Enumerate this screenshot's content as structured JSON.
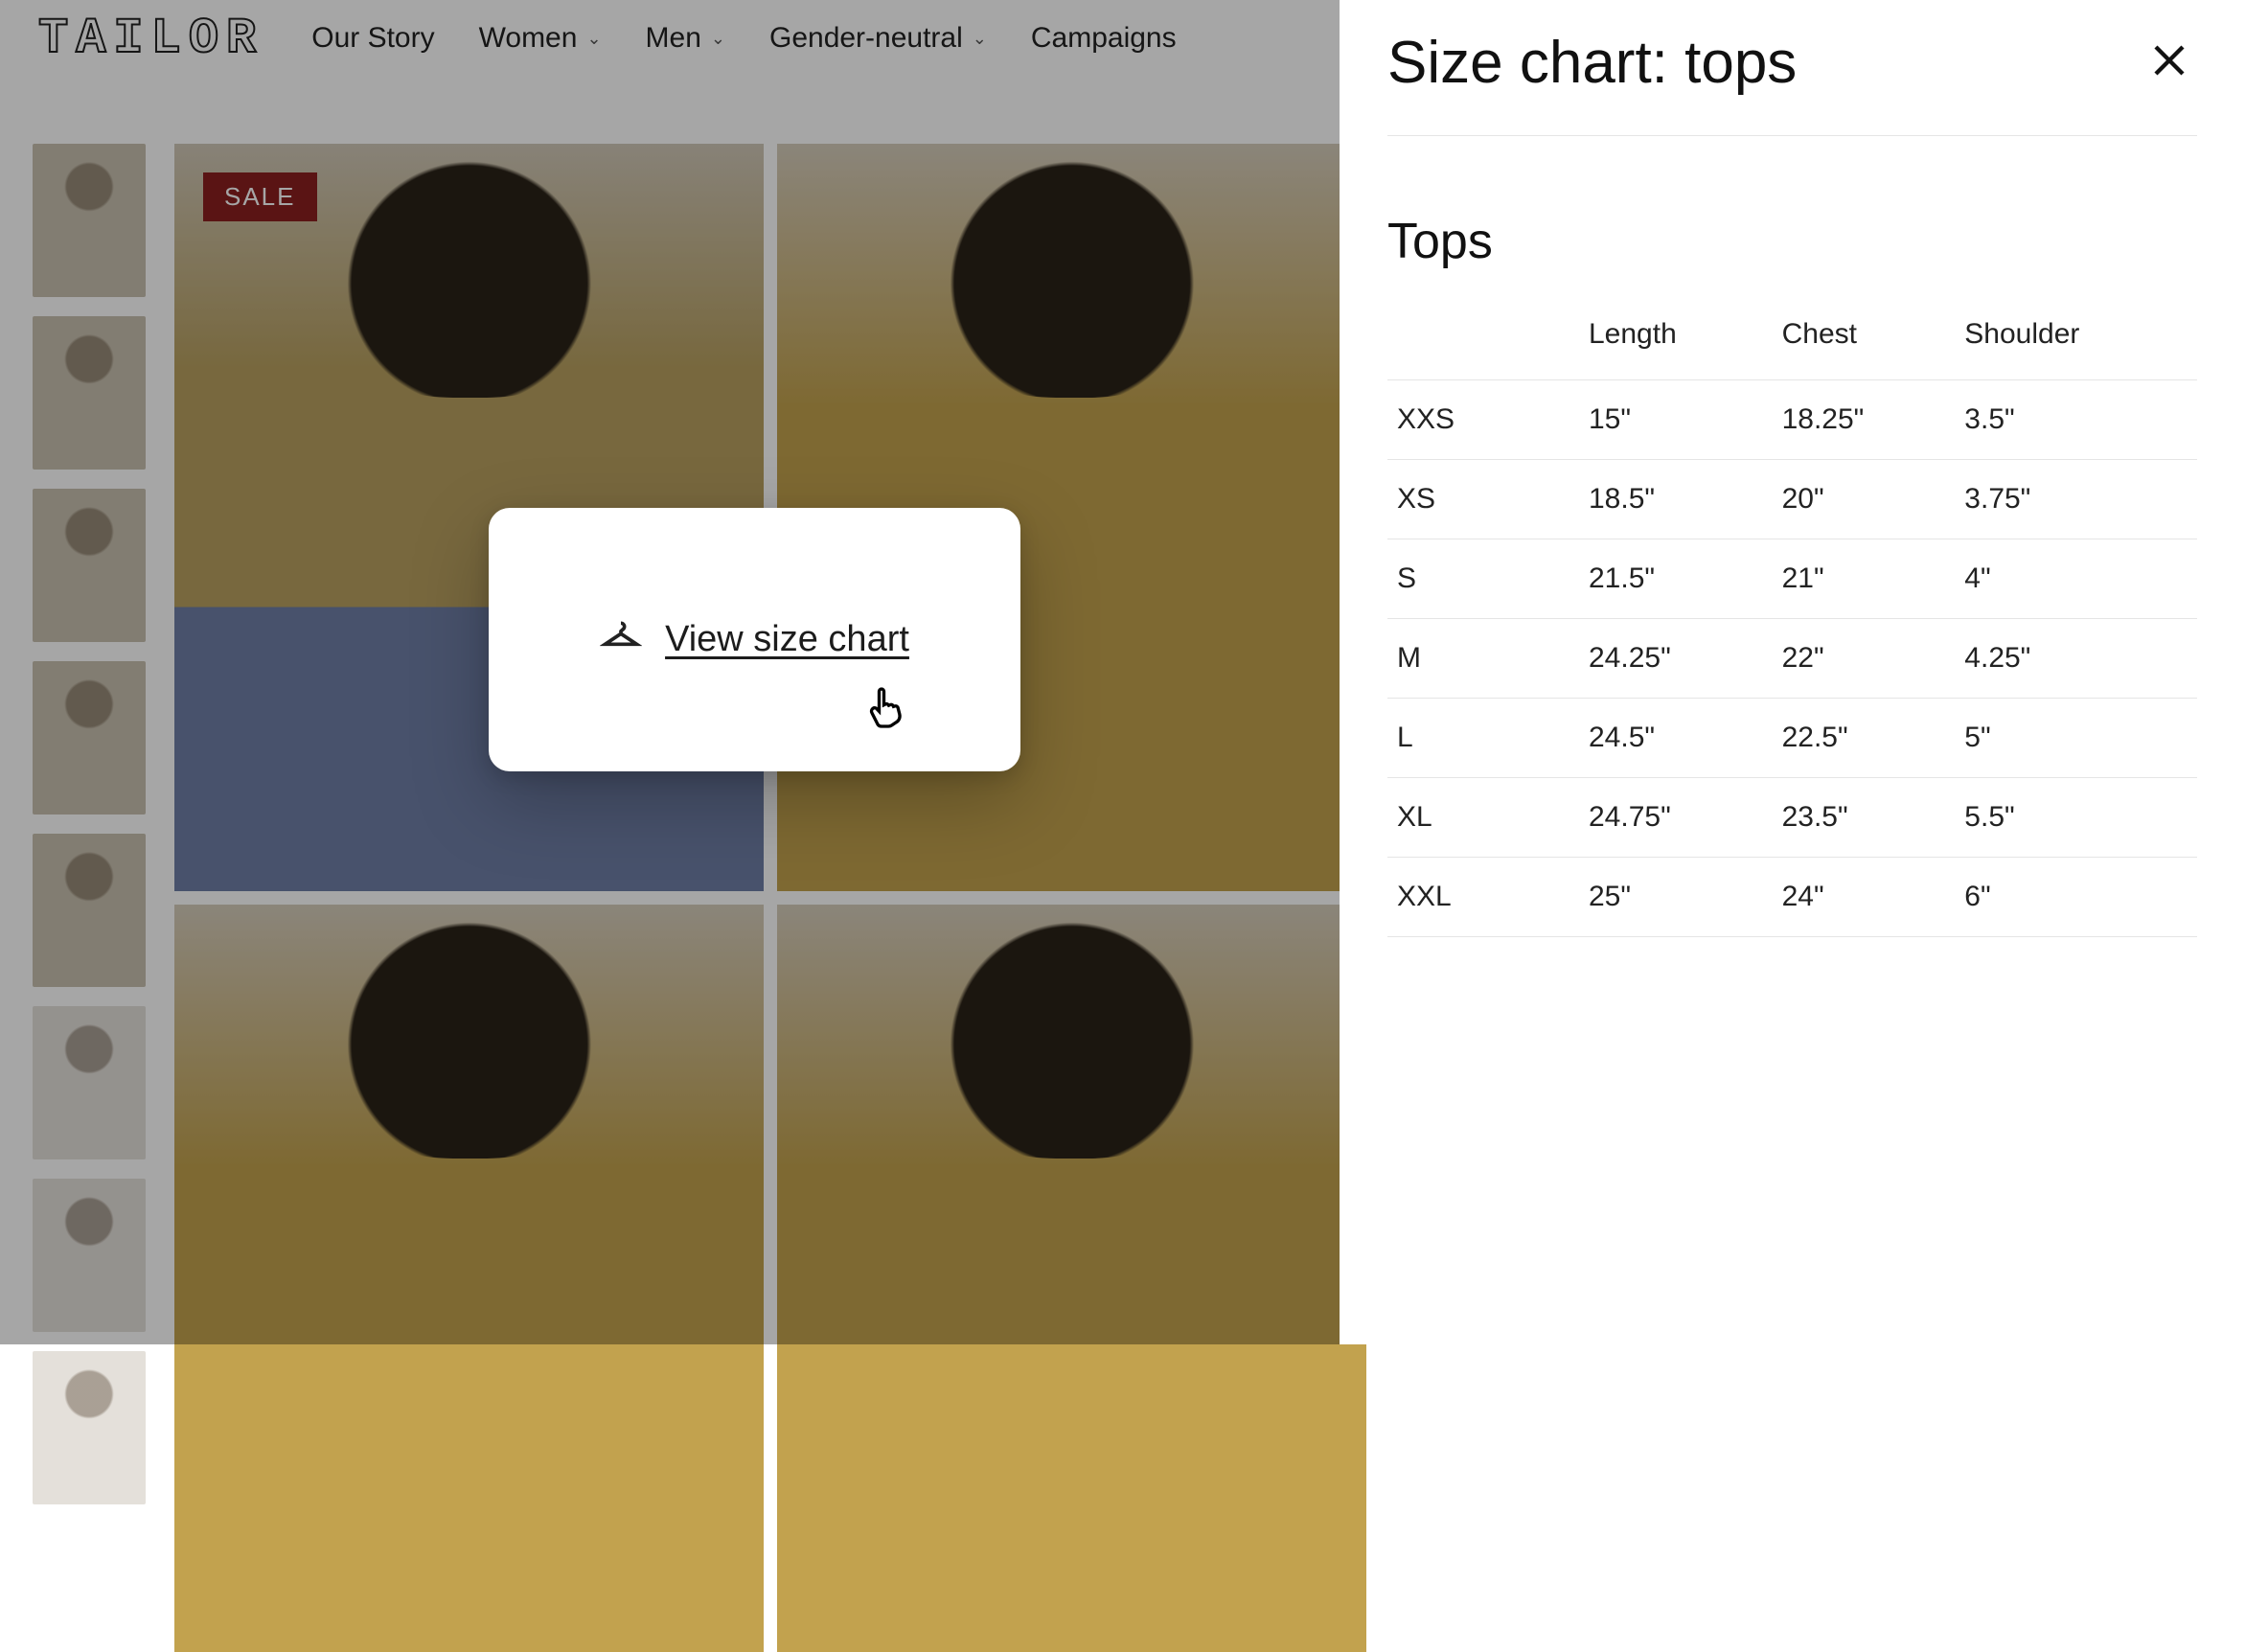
{
  "header": {
    "logo": "TAILOR",
    "nav": [
      {
        "label": "Our Story",
        "has_dropdown": false
      },
      {
        "label": "Women",
        "has_dropdown": true
      },
      {
        "label": "Men",
        "has_dropdown": true
      },
      {
        "label": "Gender-neutral",
        "has_dropdown": true
      },
      {
        "label": "Campaigns",
        "has_dropdown": false
      }
    ]
  },
  "product": {
    "sale_badge": "SALE"
  },
  "popover": {
    "link_text": "View size chart"
  },
  "drawer": {
    "title": "Size chart: tops",
    "section_title": "Tops"
  },
  "chart_data": {
    "type": "table",
    "columns": [
      "",
      "Length",
      "Chest",
      "Shoulder"
    ],
    "rows": [
      {
        "size": "XXS",
        "length": "15\"",
        "chest": "18.25\"",
        "shoulder": "3.5\""
      },
      {
        "size": "XS",
        "length": "18.5\"",
        "chest": "20\"",
        "shoulder": "3.75\""
      },
      {
        "size": "S",
        "length": "21.5\"",
        "chest": "21\"",
        "shoulder": "4\""
      },
      {
        "size": "M",
        "length": "24.25\"",
        "chest": "22\"",
        "shoulder": "4.25\""
      },
      {
        "size": "L",
        "length": "24.5\"",
        "chest": "22.5\"",
        "shoulder": "5\""
      },
      {
        "size": "XL",
        "length": "24.75\"",
        "chest": "23.5\"",
        "shoulder": "5.5\""
      },
      {
        "size": "XXL",
        "length": "25\"",
        "chest": "24\"",
        "shoulder": "6\""
      }
    ]
  }
}
